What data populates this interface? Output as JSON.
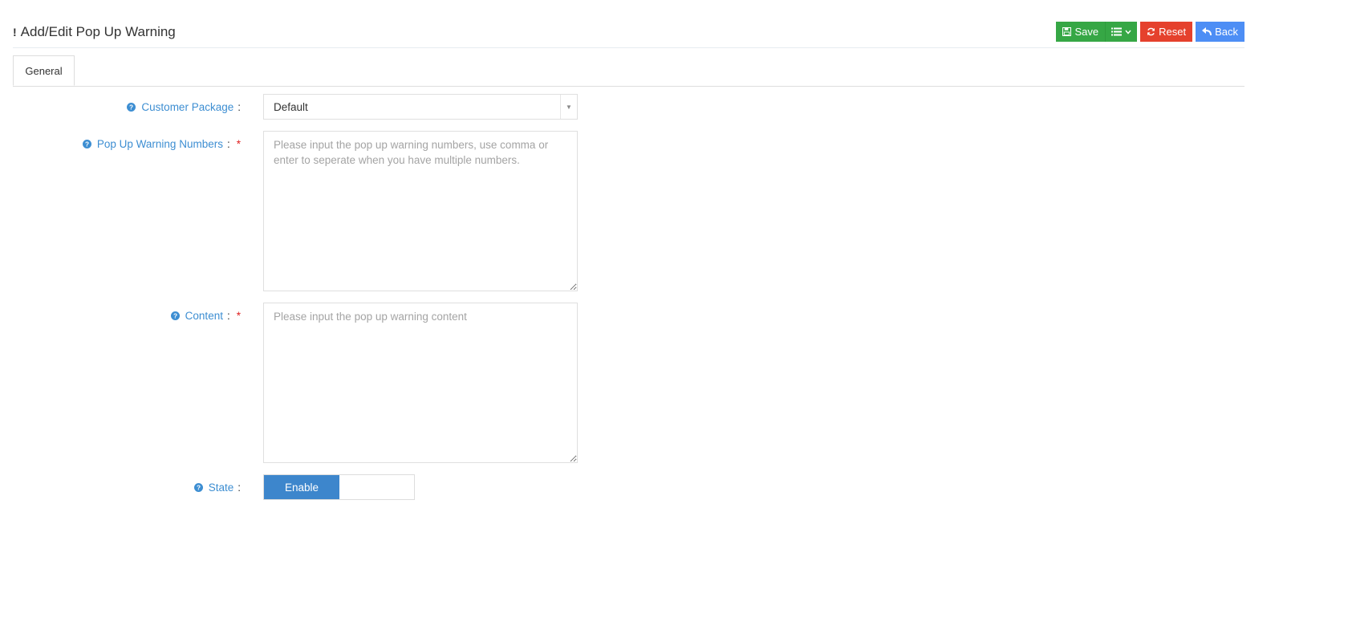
{
  "header": {
    "title": "Add/Edit Pop Up Warning",
    "title_icon": "!"
  },
  "toolbar": {
    "save_label": "Save",
    "reset_label": "Reset",
    "back_label": "Back"
  },
  "tabs": [
    {
      "label": "General",
      "active": true
    }
  ],
  "form": {
    "customer_package": {
      "label": "Customer Package",
      "colon": ":",
      "value": "Default",
      "caret": "▼"
    },
    "numbers": {
      "label": "Pop Up Warning Numbers",
      "colon": ":",
      "required": "*",
      "placeholder": "Please input the pop up warning numbers, use comma or enter to seperate when you have multiple numbers."
    },
    "content": {
      "label": "Content",
      "colon": ":",
      "required": "*",
      "placeholder": "Please input the pop up warning content"
    },
    "state": {
      "label": "State",
      "colon": ":",
      "on_label": "Enable"
    }
  },
  "colors": {
    "green": "#36a745",
    "red": "#e5412d",
    "blue": "#4d8ef5",
    "label_blue": "#3d8ed2",
    "switch_blue": "#3d86cc"
  },
  "icons": {
    "save": "floppy-disk-icon",
    "menu": "list-icon",
    "menu_chevron": "chevron-down-icon",
    "reset": "refresh-icon",
    "back": "reply-icon",
    "help": "question-circle-icon"
  }
}
